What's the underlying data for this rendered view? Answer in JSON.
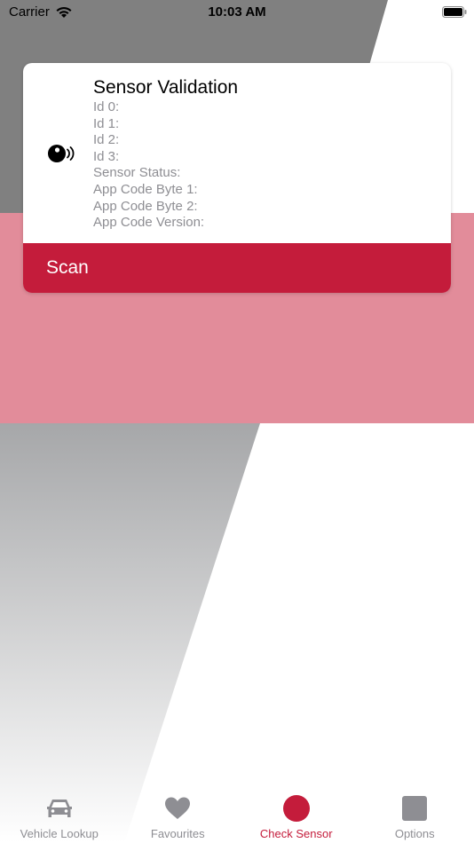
{
  "status_bar": {
    "carrier": "Carrier",
    "time": "10:03 AM"
  },
  "card": {
    "icon": "sensor-icon",
    "title": "Sensor Validation",
    "fields": [
      "Id 0:",
      "Id 1:",
      "Id 2:",
      "Id 3:",
      "Sensor Status:",
      "App Code Byte 1:",
      "App Code Byte 2:",
      "App Code Version:"
    ],
    "scan_label": "Scan"
  },
  "tab_bar": {
    "tabs": [
      {
        "label": "Vehicle Lookup",
        "icon": "car-icon",
        "selected": false
      },
      {
        "label": "Favourites",
        "icon": "heart-icon",
        "selected": false
      },
      {
        "label": "Check Sensor",
        "icon": "sensor-dot-icon",
        "selected": true
      },
      {
        "label": "Options",
        "icon": "options-square-icon",
        "selected": false
      }
    ]
  },
  "colors": {
    "accent": "#c41c3b",
    "pink_band": "#e28c9a",
    "gray_top": "#808080",
    "tab_inactive": "#8e8e93"
  }
}
